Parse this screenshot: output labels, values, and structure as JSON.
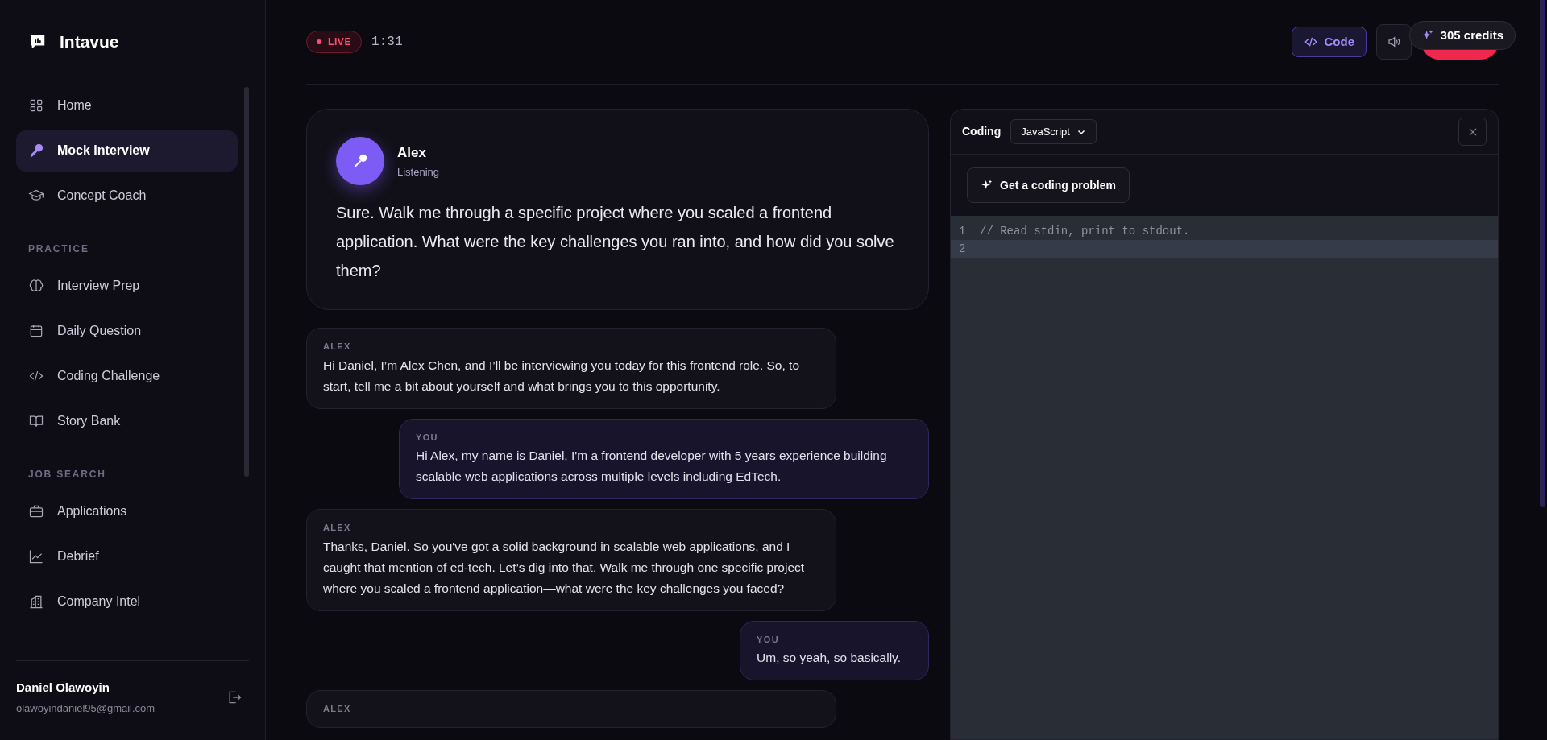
{
  "sidebar": {
    "brand": "Intavue",
    "sections": [
      {
        "items": [
          {
            "label": "Home",
            "selected": false
          },
          {
            "label": "Mock Interview",
            "selected": true
          },
          {
            "label": "Concept Coach",
            "selected": false
          }
        ]
      },
      {
        "heading": "PRACTICE",
        "items": [
          {
            "label": "Interview Prep",
            "selected": false
          },
          {
            "label": "Daily Question",
            "selected": false
          },
          {
            "label": "Coding Challenge",
            "selected": false
          },
          {
            "label": "Story Bank",
            "selected": false
          }
        ]
      },
      {
        "heading": "JOB SEARCH",
        "items": [
          {
            "label": "Applications",
            "selected": false
          },
          {
            "label": "Debrief",
            "selected": false
          },
          {
            "label": "Company Intel",
            "selected": false
          }
        ]
      }
    ],
    "user": {
      "name": "Daniel Olawoyin",
      "email": "olawoyindaniel95@gmail.com"
    }
  },
  "header": {
    "live_badge": "LIVE",
    "timer": "1:31",
    "code_button": {
      "label": "Code",
      "selected": true
    },
    "credits": "305 credits"
  },
  "question_card": {
    "name": "Alex",
    "status": "Listening",
    "text": "Sure. Walk me through a specific project where you scaled a frontend application. What were the key challenges you ran into, and how did you solve them?"
  },
  "messages": [
    {
      "kind": "interviewer",
      "speaker": "ALEX",
      "text": "Hi Daniel, I’m Alex Chen, and I’ll be interviewing you today for this frontend role. So, to start, tell me a bit about yourself and what brings you to this opportunity."
    },
    {
      "kind": "candidate",
      "speaker": "YOU",
      "text": "Hi Alex, my name is Daniel, I'm a frontend developer with 5 years experience building scalable web applications across multiple levels including EdTech."
    },
    {
      "kind": "interviewer",
      "speaker": "ALEX",
      "text": "Thanks, Daniel. So you've got a solid background in scalable web applications, and I caught that mention of ed-tech. Let’s dig into that. Walk me through one specific project where you scaled a frontend application—what were the key challenges you faced?"
    },
    {
      "kind": "candidate",
      "speaker": "YOU",
      "text": "Um, so yeah, so basically."
    },
    {
      "kind": "interviewer",
      "speaker": "ALEX"
    }
  ],
  "coding_panel": {
    "title": "Coding",
    "language": "JavaScript",
    "problem_button": "Get a coding problem",
    "lines": [
      {
        "number": "1",
        "text": "// Read stdin, print to stdout.",
        "active": false
      },
      {
        "number": "2",
        "active": true
      }
    ]
  }
}
